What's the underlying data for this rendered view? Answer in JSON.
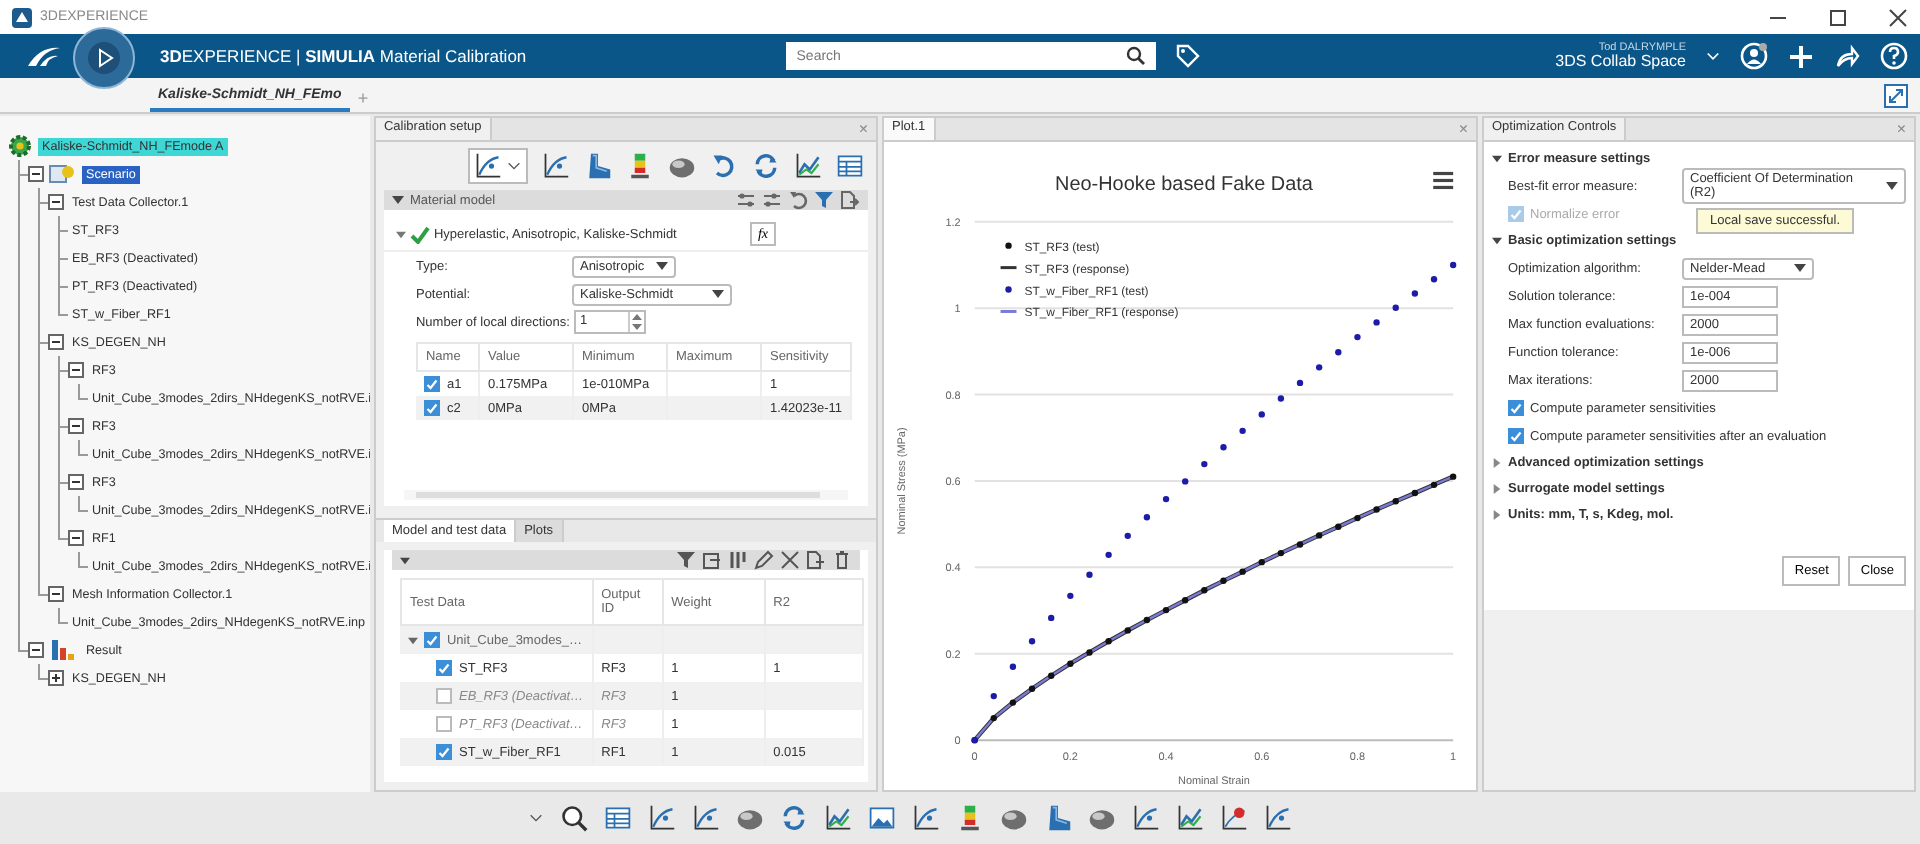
{
  "window": {
    "title": "3DEXPERIENCE"
  },
  "header": {
    "brand": "**3D**EXPERIENCE | **SIMULIA** Material Calibration",
    "search": {
      "placeholder": "Search"
    },
    "user": "Tod DALRYMPLE",
    "space": "3DS Collab Space"
  },
  "tabs": [
    {
      "label": "Kaliske-Schmidt_NH_FEmo",
      "selected": true
    }
  ],
  "new_tab": "+",
  "tree": [
    {
      "label": "Kaliske-Schmidt_NH_FEmode A",
      "kind": "root",
      "selected": false,
      "children": [
        {
          "label": "Scenario",
          "kind": "scenario",
          "selected": true,
          "expanded": true,
          "children": [
            {
              "label": "Test Data Collector.1",
              "selected": false,
              "expanded": true,
              "children": [
                {
                  "label": "ST_RF3",
                  "selected": false
                },
                {
                  "label": "EB_RF3 (Deactivated)",
                  "selected": false
                },
                {
                  "label": "PT_RF3 (Deactivated)",
                  "selected": false
                },
                {
                  "label": "ST_w_Fiber_RF1",
                  "selected": false
                }
              ]
            },
            {
              "label": "KS_DEGEN_NH",
              "selected": false,
              "expanded": true,
              "children": [
                {
                  "label": "RF3",
                  "selected": false,
                  "expanded": true,
                  "children": [
                    {
                      "label": "Unit_Cube_3modes_2dirs_NHdegenKS_notRVE.i",
                      "selected": false
                    }
                  ]
                },
                {
                  "label": "RF3",
                  "selected": false,
                  "expanded": true,
                  "children": [
                    {
                      "label": "Unit_Cube_3modes_2dirs_NHdegenKS_notRVE.i",
                      "selected": false
                    }
                  ]
                },
                {
                  "label": "RF3",
                  "selected": false,
                  "expanded": true,
                  "children": [
                    {
                      "label": "Unit_Cube_3modes_2dirs_NHdegenKS_notRVE.i",
                      "selected": false
                    }
                  ]
                },
                {
                  "label": "RF1",
                  "selected": false,
                  "expanded": true,
                  "children": [
                    {
                      "label": "Unit_Cube_3modes_2dirs_NHdegenKS_notRVE.i",
                      "selected": false
                    }
                  ]
                }
              ]
            },
            {
              "label": "Mesh Information Collector.1",
              "selected": false,
              "expanded": true,
              "children": [
                {
                  "label": "Unit_Cube_3modes_2dirs_NHdegenKS_notRVE.inp",
                  "selected": false
                }
              ]
            }
          ]
        },
        {
          "label": "Result",
          "kind": "result",
          "selected": false,
          "expanded": true,
          "children": [
            {
              "label": "KS_DEGEN_NH",
              "selected": false,
              "expanded": false
            }
          ]
        }
      ]
    }
  ],
  "calibration": {
    "title": "Calibration setup",
    "close": "×",
    "section": "Material model",
    "model": {
      "label": "Hyperelastic, Anisotropic, Kaliske-Schmidt",
      "valid": true,
      "fx": "fx"
    },
    "fields": [
      {
        "label": "Type:",
        "value": "Anisotropic",
        "kind": "dropdown"
      },
      {
        "label": "Potential:",
        "value": "Kaliske-Schmidt",
        "kind": "dropdown"
      },
      {
        "label": "Number of local directions:",
        "value": "1",
        "kind": "spinner"
      }
    ],
    "params": {
      "columns": [
        "Name",
        "Value",
        "Minimum",
        "Maximum",
        "Sensitivity"
      ],
      "rows": [
        {
          "checked": true,
          "name": "a1",
          "value": "0.175MPa",
          "minimum": "1e-010MPa",
          "sensitivity": "1"
        },
        {
          "checked": true,
          "name": "c2",
          "value": "0MPa",
          "minimum": "0MPa",
          "sensitivity": "1.42023e-11"
        }
      ]
    },
    "tabs": [
      {
        "label": "Model and test data",
        "selected": true
      },
      {
        "label": "Plots",
        "selected": false
      }
    ],
    "test_data": {
      "columns": [
        "Test Data",
        "Output ID",
        "Weight",
        "R2"
      ],
      "group": {
        "label": "Unit_Cube_3modes_…",
        "checked": true,
        "expanded": true
      },
      "rows": [
        {
          "label": "ST_RF3",
          "output_id": "RF3",
          "weight": "1",
          "r2": "1",
          "checked": true,
          "deactivated": false
        },
        {
          "label": "EB_RF3 (Deactivat…",
          "output_id": "RF3",
          "weight": "1",
          "checked": false,
          "deactivated": true
        },
        {
          "label": "PT_RF3 (Deactivat…",
          "output_id": "RF3",
          "weight": "1",
          "checked": false,
          "deactivated": true
        },
        {
          "label": "ST_w_Fiber_RF1",
          "output_id": "RF1",
          "weight": "1",
          "r2": "0.015",
          "checked": true,
          "deactivated": false
        }
      ]
    }
  },
  "plot": {
    "tab": "Plot.1",
    "close": "×",
    "chart_data": {
      "type": "scatter",
      "title": "Neo-Hooke based Fake Data",
      "xlabel": "Nominal Strain",
      "ylabel": "Nominal Stress (MPa)",
      "x": [
        0,
        0.04,
        0.08,
        0.12,
        0.16,
        0.2,
        0.24,
        0.28,
        0.32,
        0.36,
        0.4,
        0.44,
        0.48,
        0.52,
        0.56,
        0.6,
        0.64,
        0.68,
        0.72,
        0.76,
        0.8,
        0.84,
        0.88,
        0.92,
        0.96,
        1
      ],
      "series": [
        {
          "name": "ST_RF3 (test)",
          "marker": "circle",
          "color": "#111111",
          "values": [
            0,
            0.051,
            0.087,
            0.119,
            0.149,
            0.177,
            0.203,
            0.229,
            0.254,
            0.278,
            0.301,
            0.324,
            0.347,
            0.369,
            0.39,
            0.412,
            0.433,
            0.453,
            0.474,
            0.494,
            0.514,
            0.534,
            0.553,
            0.572,
            0.591,
            0.61
          ]
        },
        {
          "name": "ST_RF3 (response)",
          "type": "line",
          "marker": "none",
          "color": "#333333",
          "values": [
            0,
            0.051,
            0.087,
            0.119,
            0.149,
            0.177,
            0.203,
            0.229,
            0.254,
            0.278,
            0.301,
            0.324,
            0.347,
            0.369,
            0.39,
            0.412,
            0.433,
            0.453,
            0.474,
            0.494,
            0.514,
            0.534,
            0.553,
            0.572,
            0.591,
            0.61
          ]
        },
        {
          "name": "ST_w_Fiber_RF1 (test)",
          "marker": "circle",
          "color": "#1c1ca8",
          "values": [
            0,
            0.102,
            0.17,
            0.229,
            0.283,
            0.334,
            0.383,
            0.429,
            0.473,
            0.516,
            0.558,
            0.599,
            0.639,
            0.678,
            0.716,
            0.754,
            0.791,
            0.827,
            0.863,
            0.898,
            0.933,
            0.967,
            1.001,
            1.034,
            1.067,
            1.1
          ]
        },
        {
          "name": "ST_w_Fiber_RF1 (response)",
          "type": "line",
          "marker": "none",
          "color": "#7b7bd6",
          "values": [
            0,
            0.051,
            0.087,
            0.119,
            0.149,
            0.177,
            0.203,
            0.229,
            0.254,
            0.278,
            0.301,
            0.324,
            0.347,
            0.369,
            0.39,
            0.412,
            0.433,
            0.453,
            0.474,
            0.494,
            0.514,
            0.534,
            0.553,
            0.572,
            0.591,
            0.61
          ]
        }
      ],
      "grid": true,
      "legend": "upper left",
      "xlim": [
        0,
        1
      ],
      "ylim": [
        0,
        1.2
      ],
      "xticks": [
        0,
        0.2,
        0.4,
        0.6,
        0.8,
        1
      ],
      "yticks": [
        0,
        0.2,
        0.4,
        0.6,
        0.8,
        1,
        1.2
      ]
    }
  },
  "optimization": {
    "title": "Optimization Controls",
    "close": "×",
    "tooltip": "Local save successful.",
    "sections": [
      {
        "title": "Error measure settings",
        "expanded": true,
        "items": [
          {
            "kind": "dropdown",
            "label": "Best-fit error measure:",
            "value": "Coefficient Of Determination (R2)"
          },
          {
            "kind": "checkbox",
            "label": "Normalize error",
            "checked": true,
            "disabled": true
          }
        ]
      },
      {
        "title": "Basic optimization settings",
        "expanded": true,
        "items": [
          {
            "kind": "dropdown",
            "label": "Optimization algorithm:",
            "value": "Nelder-Mead"
          },
          {
            "kind": "field",
            "label": "Solution tolerance:",
            "value": "1e-004"
          },
          {
            "kind": "field",
            "label": "Max function evaluations:",
            "value": "2000"
          },
          {
            "kind": "field",
            "label": "Function tolerance:",
            "value": "1e-006"
          },
          {
            "kind": "field",
            "label": "Max iterations:",
            "value": "2000"
          },
          {
            "kind": "checkbox",
            "label": "Compute parameter sensitivities",
            "checked": true,
            "disabled": false
          },
          {
            "kind": "checkbox",
            "label": "Compute parameter sensitivities after an evaluation",
            "checked": true,
            "disabled": false
          }
        ]
      },
      {
        "title": "Advanced optimization settings",
        "expanded": false
      },
      {
        "title": "Surrogate model settings",
        "expanded": false
      },
      {
        "title": "Units: mm, T, s, Kdeg, mol.",
        "expanded": false
      }
    ],
    "buttons": [
      "Reset",
      "Close"
    ]
  }
}
